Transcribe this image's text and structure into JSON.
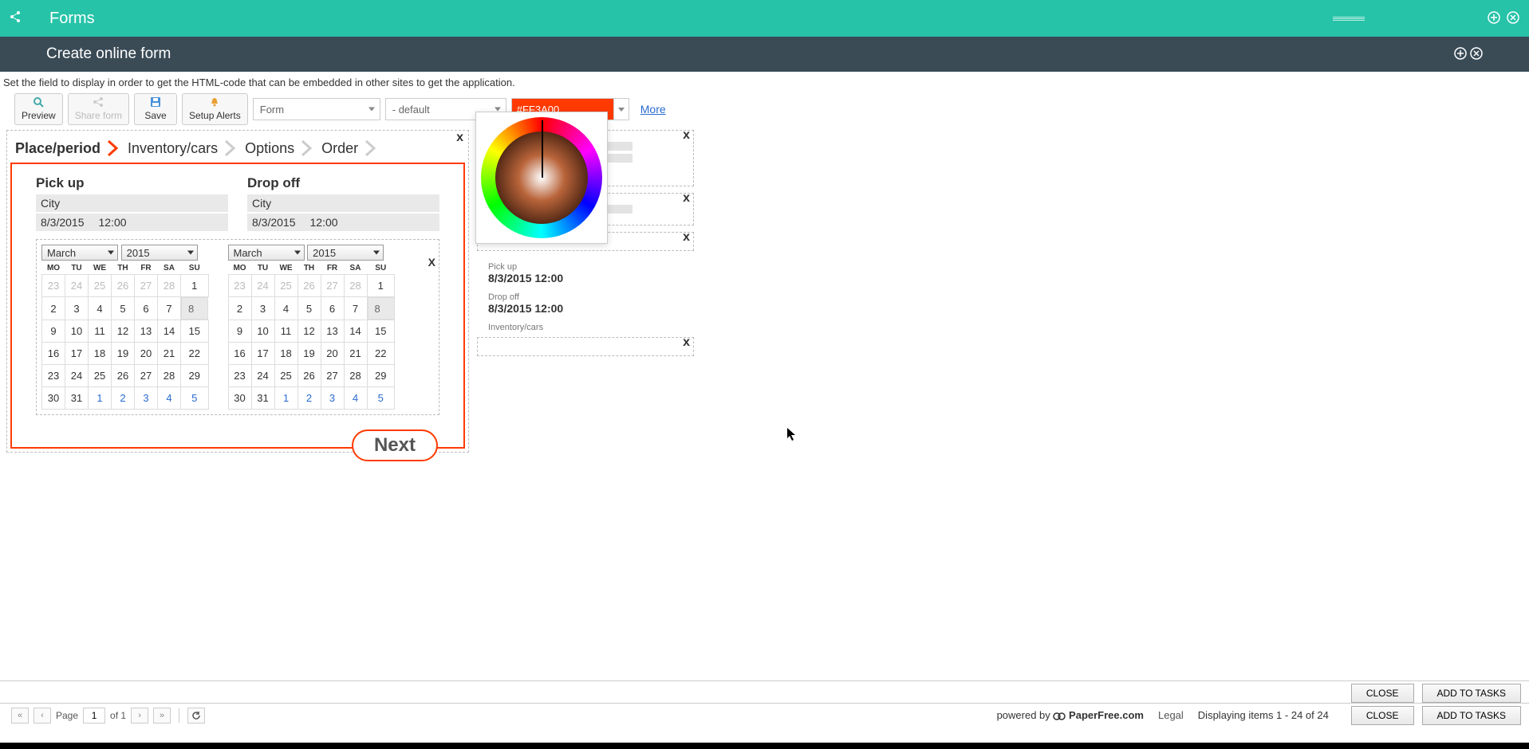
{
  "topbar": {
    "title": "Forms"
  },
  "subheader": {
    "title": "Create online form"
  },
  "instruction": "Set the field to display in order to get the HTML-code that can be embedded in other sites to get the application.",
  "toolbar": {
    "preview": "Preview",
    "share": "Share form",
    "save": "Save",
    "alerts": "Setup Alerts",
    "form_sel": "Form",
    "default_sel": "- default",
    "color": "#FF3A00",
    "more": "More"
  },
  "tabs": [
    "Place/period",
    "Inventory/cars",
    "Options",
    "Order"
  ],
  "pickup": {
    "title": "Pick up",
    "city": "City",
    "date": "8/3/2015",
    "time": "12:00",
    "month": "March",
    "year": "2015"
  },
  "dropoff": {
    "title": "Drop off",
    "city": "City",
    "date": "8/3/2015",
    "time": "12:00",
    "month": "March",
    "year": "2015"
  },
  "weekdays": [
    "MO",
    "TU",
    "WE",
    "TH",
    "FR",
    "SA",
    "SU"
  ],
  "cal_rows": [
    {
      "cells": [
        "23",
        "24",
        "25",
        "26",
        "27",
        "28",
        "1"
      ],
      "out": [
        0,
        1,
        2,
        3,
        4,
        5
      ],
      "sel": null
    },
    {
      "cells": [
        "2",
        "3",
        "4",
        "5",
        "6",
        "7",
        "8"
      ],
      "out": [],
      "sel": 6
    },
    {
      "cells": [
        "9",
        "10",
        "11",
        "12",
        "13",
        "14",
        "15"
      ],
      "out": [],
      "sel": null
    },
    {
      "cells": [
        "16",
        "17",
        "18",
        "19",
        "20",
        "21",
        "22"
      ],
      "out": [],
      "sel": null
    },
    {
      "cells": [
        "23",
        "24",
        "25",
        "26",
        "27",
        "28",
        "29"
      ],
      "out": [],
      "sel": null
    },
    {
      "cells": [
        "30",
        "31",
        "1",
        "2",
        "3",
        "4",
        "5"
      ],
      "out": [],
      "nextm": [
        2,
        3,
        4,
        5,
        6
      ],
      "sel": null
    }
  ],
  "next_btn": "Next",
  "right": {
    "pickup_lbl": "Pick up",
    "pickup_val": "8/3/2015 12:00",
    "dropoff_lbl": "Drop off",
    "dropoff_val": "8/3/2015 12:00",
    "inv_lbl": "Inventory/cars"
  },
  "footer": {
    "close": "CLOSE",
    "add": "ADD TO TASKS",
    "page_lbl": "Page",
    "page_val": "1",
    "page_of": "of 1",
    "powered": "powered by",
    "brand": "PaperFree.com",
    "legal": "Legal",
    "range": "Displaying items 1 - 24 of 24"
  }
}
